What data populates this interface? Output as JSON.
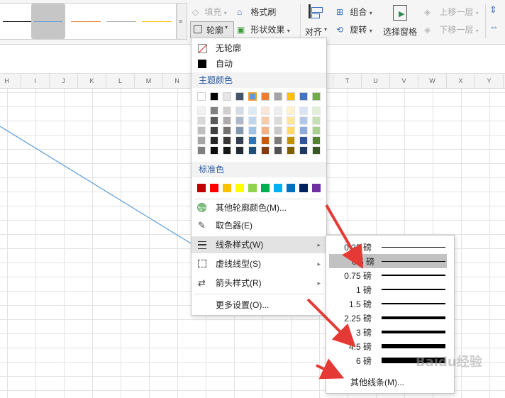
{
  "ribbon": {
    "fill_label": "填充",
    "format_painter_label": "格式刷",
    "outline_label": "轮廓",
    "shape_effect_label": "形状效果",
    "align_label": "对齐",
    "group_label": "组合",
    "rotate_label": "旋转",
    "selection_pane_label": "选择窗格",
    "bring_forward_label": "上移一层",
    "send_backward_label": "下移一层",
    "line_colors": [
      "#000000",
      "#5b9bd5",
      "#ed7d31",
      "#a5a5a5",
      "#ffc000"
    ]
  },
  "columns": [
    "H",
    "I",
    "J",
    "K",
    "L",
    "M",
    "N",
    "O",
    "P",
    "Q",
    "R",
    "S",
    "T",
    "U",
    "V",
    "W",
    "X",
    "Y"
  ],
  "menu": {
    "no_outline": "无轮廓",
    "auto": "自动",
    "theme_colors_header": "主题颜色",
    "standard_colors_header": "标准色",
    "theme_colors": [
      "#ffffff",
      "#000000",
      "#e7e6e6",
      "#44546a",
      "#5b9bd5",
      "#ed7d31",
      "#a5a5a5",
      "#ffc000",
      "#4472c4",
      "#70ad47"
    ],
    "theme_shades": [
      [
        "#f2f2f2",
        "#808080",
        "#d0cece",
        "#d6dce5",
        "#deebf7",
        "#fbe5d6",
        "#ededed",
        "#fff2cc",
        "#dae3f3",
        "#e2f0d9"
      ],
      [
        "#d9d9d9",
        "#595959",
        "#aeabab",
        "#adb9ca",
        "#bdd7ee",
        "#f8cbad",
        "#dbdbdb",
        "#ffe699",
        "#b4c7e7",
        "#c5e0b4"
      ],
      [
        "#bfbfbf",
        "#404040",
        "#757171",
        "#8497b0",
        "#9dc3e6",
        "#f4b183",
        "#c9c9c9",
        "#ffd966",
        "#8faadc",
        "#a9d18e"
      ],
      [
        "#a6a6a6",
        "#262626",
        "#3b3838",
        "#333f50",
        "#2e75b6",
        "#c55a11",
        "#7b7b7b",
        "#bf9000",
        "#2f5597",
        "#548235"
      ],
      [
        "#7f7f7f",
        "#0d0d0d",
        "#171616",
        "#222a35",
        "#1f4e79",
        "#843c0c",
        "#525252",
        "#7f6000",
        "#203864",
        "#385723"
      ]
    ],
    "standard_colors": [
      "#c00000",
      "#ff0000",
      "#ffc000",
      "#ffff00",
      "#92d050",
      "#00b050",
      "#00b0f0",
      "#0070c0",
      "#002060",
      "#7030a0"
    ],
    "other_colors": "其他轮廓颜色(M)...",
    "eyedropper": "取色器(E)",
    "line_style": "线条样式(W)",
    "dash_type": "虚线线型(S)",
    "arrow_style": "箭头样式(R)",
    "more_settings": "更多设置(O)..."
  },
  "submenu": {
    "weights": [
      "0.25 磅",
      "0.5 磅",
      "0.75 磅",
      "1 磅",
      "1.5 磅",
      "2.25 磅",
      "3 磅",
      "4.5 磅",
      "6 磅"
    ],
    "other_lines": "其他线条(M)..."
  },
  "watermark": "Baidu经验"
}
